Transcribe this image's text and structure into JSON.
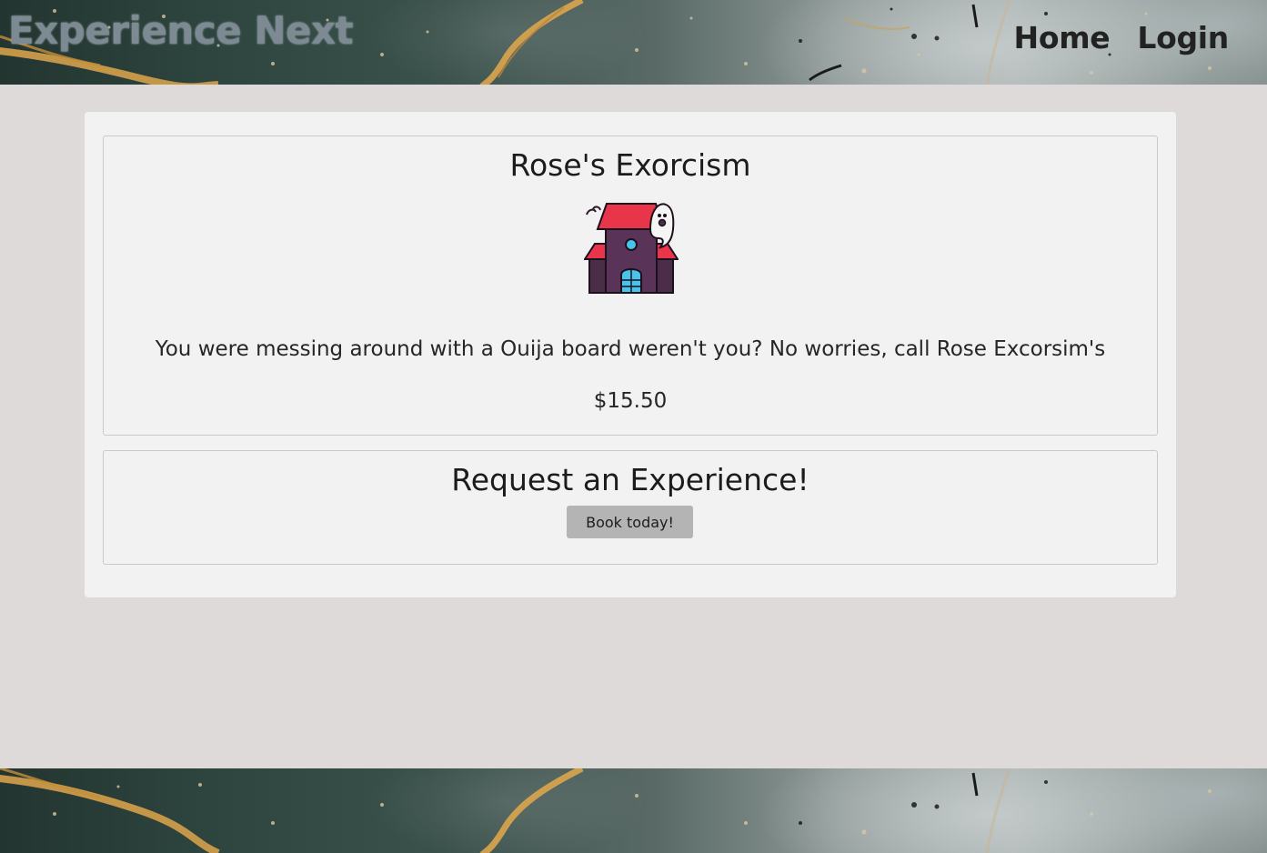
{
  "header": {
    "brand": "Experience Next",
    "nav": [
      "Home",
      "Login"
    ]
  },
  "experience": {
    "title": "Rose's Exorcism",
    "icon": "haunted-house-icon",
    "description": "You were messing around with a Ouija board weren't you? No worries, call Rose Excorsim's",
    "price": "$15.50"
  },
  "request": {
    "title": "Request an Experience!",
    "button_label": "Book today!"
  },
  "colors": {
    "page_background": "#dddad9",
    "panel_background": "#f2f2f2",
    "button_background": "#b4b4b4",
    "brand_text": "#7d8a94",
    "roof_red": "#e8354a",
    "house_purple": "#4b2d4a",
    "window_blue": "#49c3ea"
  }
}
